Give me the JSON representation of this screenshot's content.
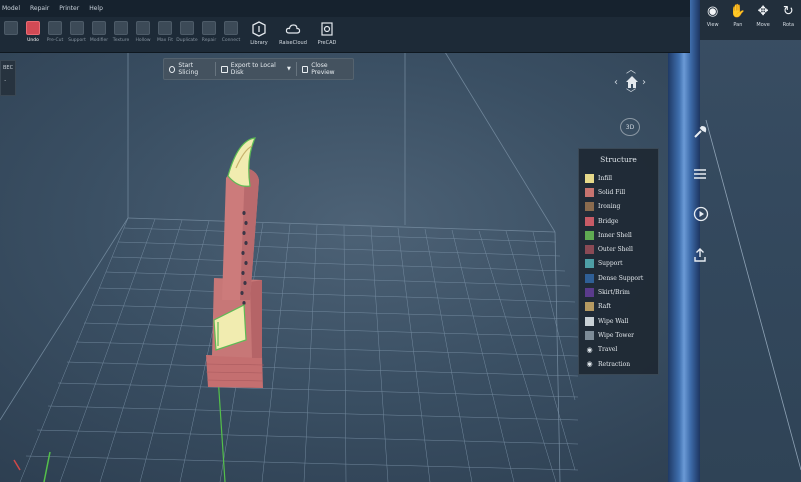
{
  "menubar": {
    "items": [
      "Model",
      "Repair",
      "Printer",
      "Help"
    ]
  },
  "toolbar": {
    "tools": [
      {
        "label": "",
        "icon": "tool-icon",
        "active": false
      },
      {
        "label": "Undo",
        "icon": "undo-icon",
        "active": true
      },
      {
        "label": "Pre-Cut",
        "icon": "cut-icon",
        "active": false
      },
      {
        "label": "Support",
        "icon": "support-icon",
        "active": false
      },
      {
        "label": "Modifier",
        "icon": "modifier-icon",
        "active": false
      },
      {
        "label": "Texture",
        "icon": "texture-icon",
        "active": false
      },
      {
        "label": "Hollow",
        "icon": "hollow-icon",
        "active": false
      },
      {
        "label": "Max Fit",
        "icon": "max-fit-icon",
        "active": false
      },
      {
        "label": "Duplicate",
        "icon": "duplicate-icon",
        "active": false
      },
      {
        "label": "Repair",
        "icon": "repair-icon",
        "active": false
      },
      {
        "label": "Connect",
        "icon": "connect-icon",
        "active": false
      }
    ],
    "big_tools": [
      {
        "label": "Library",
        "icon": "library-icon"
      },
      {
        "label": "RaiseCloud",
        "icon": "cloud-icon"
      },
      {
        "label": "PreCAD",
        "icon": "precad-icon"
      }
    ]
  },
  "slicebar": {
    "start_slicing": "Start Slicing",
    "export": "Export to Local Disk",
    "close_preview": "Close Preview"
  },
  "leftpanel": {
    "text": "BEC"
  },
  "nav": {
    "label_3d": "3D"
  },
  "legend": {
    "title": "Structure",
    "items": [
      {
        "label": "Infill",
        "color": "#e6d98a"
      },
      {
        "label": "Solid Fill",
        "color": "#c7736f"
      },
      {
        "label": "Ironing",
        "color": "#8a6b4e"
      },
      {
        "label": "Bridge",
        "color": "#c85b66"
      },
      {
        "label": "Inner Shell",
        "color": "#5faa52"
      },
      {
        "label": "Outer Shell",
        "color": "#8a4a55"
      },
      {
        "label": "Support",
        "color": "#4e9fa6"
      },
      {
        "label": "Dense Support",
        "color": "#2f5f96"
      },
      {
        "label": "Skirt/Brim",
        "color": "#5a3b8c"
      },
      {
        "label": "Raft",
        "color": "#b59a62"
      },
      {
        "label": "Wipe Wall",
        "color": "#c9d1d6"
      },
      {
        "label": "Wipe Tower",
        "color": "#7c8b97"
      },
      {
        "label": "Travel",
        "color": "",
        "eye": true
      },
      {
        "label": "Retraction",
        "color": "",
        "eye": true
      }
    ]
  },
  "viewtools": [
    {
      "label": "View",
      "icon": "eye-icon"
    },
    {
      "label": "Pan",
      "icon": "hand-icon"
    },
    {
      "label": "Move",
      "icon": "move-icon"
    },
    {
      "label": "Rota",
      "icon": "rotate-icon"
    }
  ],
  "colors": {
    "model": "#c87a7a",
    "model_highlight": "#f1ecb0",
    "accent_red": "#d24a55",
    "panel_blue": "#3f6fae"
  }
}
